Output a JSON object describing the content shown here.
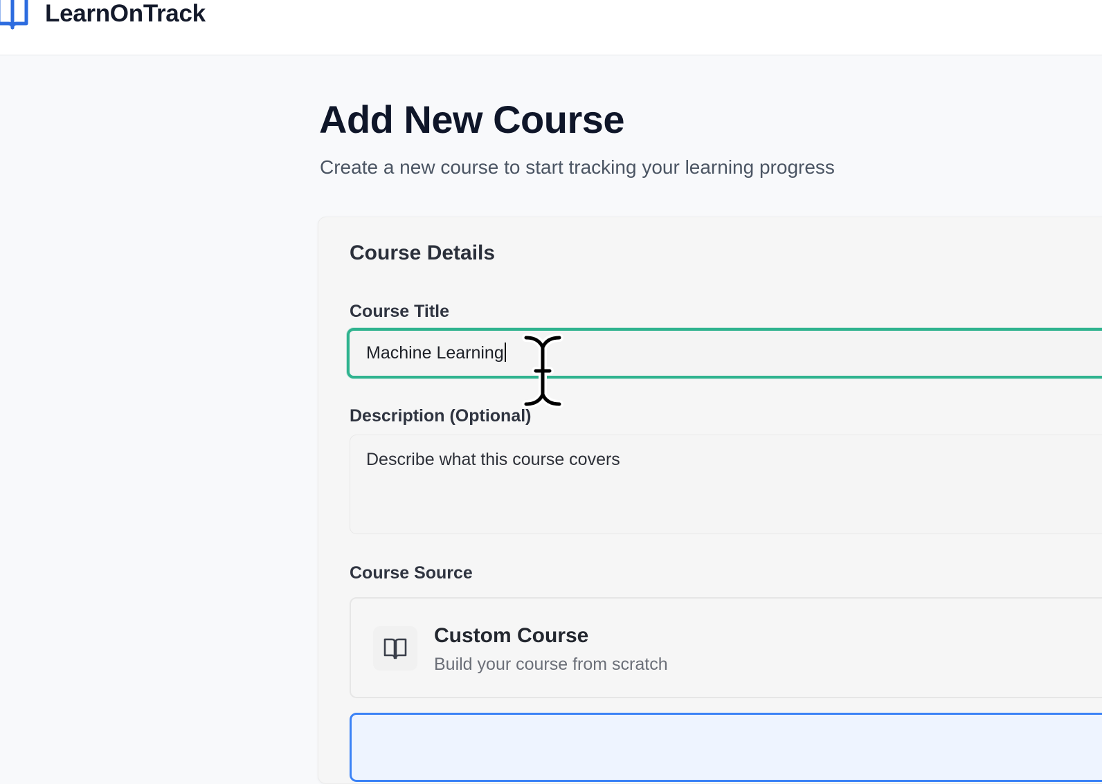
{
  "app": {
    "name": "LearnOnTrack",
    "logo_icon": "open-book-icon"
  },
  "page": {
    "title": "Add New Course",
    "subtitle": "Create a new course to start tracking your learning progress"
  },
  "form": {
    "section_title": "Course Details",
    "course_title": {
      "label": "Course Title",
      "value": "Machine Learning"
    },
    "description": {
      "label": "Description (Optional)",
      "placeholder": "Describe what this course covers",
      "value": ""
    },
    "course_source": {
      "label": "Course Source",
      "options": [
        {
          "icon": "open-book-icon",
          "title": "Custom Course",
          "description": "Build your course from scratch"
        }
      ]
    }
  },
  "colors": {
    "focus_ring": "#2fb38f",
    "selected_option_border": "#3b82f6",
    "heading": "#0f1629"
  }
}
